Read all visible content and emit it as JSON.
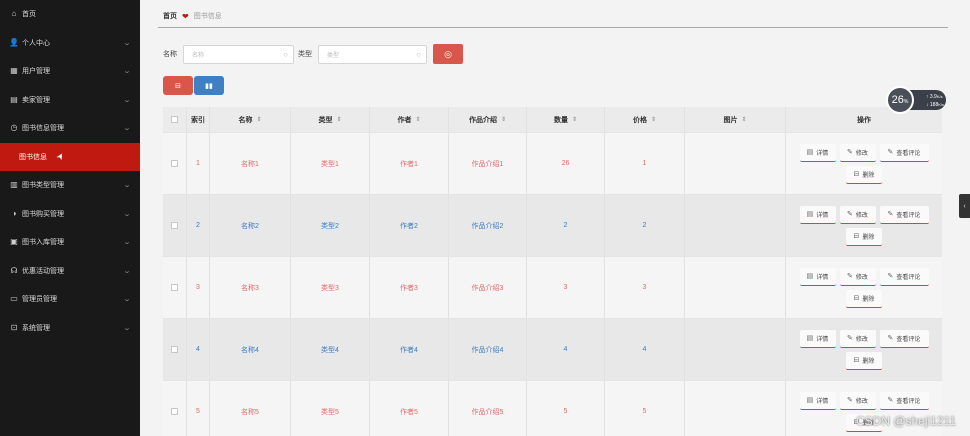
{
  "sidebar": {
    "items": [
      {
        "icon": "⌂",
        "label": "首页",
        "arrow": false
      },
      {
        "icon": "👤",
        "label": "个人中心",
        "arrow": true
      },
      {
        "icon": "▦",
        "label": "用户管理",
        "arrow": true
      },
      {
        "icon": "▤",
        "label": "卖家管理",
        "arrow": true
      },
      {
        "icon": "◷",
        "label": "图书信息管理",
        "arrow": true
      },
      {
        "icon": "",
        "label": "图书信息",
        "arrow": false
      },
      {
        "icon": "▥",
        "label": "图书类型管理",
        "arrow": true
      },
      {
        "icon": "◑",
        "label": "图书购买管理",
        "arrow": true
      },
      {
        "icon": "▣",
        "label": "图书入库管理",
        "arrow": true
      },
      {
        "icon": "☊",
        "label": "优惠活动管理",
        "arrow": true
      },
      {
        "icon": "▭",
        "label": "管理员管理",
        "arrow": true
      },
      {
        "icon": "⊡",
        "label": "系统管理",
        "arrow": true
      }
    ]
  },
  "breadcrumb": {
    "home": "首页",
    "current": "图书信息"
  },
  "search": {
    "name_label": "名称",
    "name_placeholder": "名称",
    "type_label": "类型",
    "type_placeholder": "类型"
  },
  "toolbar": {
    "delete_icon": "🗑",
    "chart_icon": "📊"
  },
  "table": {
    "headers": [
      "索引",
      "名称",
      "类型",
      "作者",
      "作品介绍",
      "数量",
      "价格",
      "图片",
      "操作"
    ],
    "rows": [
      {
        "index": "1",
        "name": "名称1",
        "type": "类型1",
        "author": "作者1",
        "intro": "作品介绍1",
        "qty": "26",
        "price": "1"
      },
      {
        "index": "2",
        "name": "名称2",
        "type": "类型2",
        "author": "作者2",
        "intro": "作品介绍2",
        "qty": "2",
        "price": "2"
      },
      {
        "index": "3",
        "name": "名称3",
        "type": "类型3",
        "author": "作者3",
        "intro": "作品介绍3",
        "qty": "3",
        "price": "3"
      },
      {
        "index": "4",
        "name": "名称4",
        "type": "类型4",
        "author": "作者4",
        "intro": "作品介绍4",
        "qty": "4",
        "price": "4"
      },
      {
        "index": "5",
        "name": "名称5",
        "type": "类型5",
        "author": "作者5",
        "intro": "作品介绍5",
        "qty": "5",
        "price": "5"
      }
    ],
    "actions": {
      "detail": "详情",
      "edit": "修改",
      "review": "查看评论",
      "delete": "删除"
    }
  },
  "widget": {
    "percent": "26",
    "unit": "%",
    "up": "3.9",
    "up_unit": "K/s",
    "down": "188",
    "down_unit": "K/s"
  },
  "watermark": "CSDN @sheji1211",
  "colors": {
    "accent": "#c0190f",
    "search_btn": "#d9574a",
    "chart_btn": "#3f7fc4"
  }
}
